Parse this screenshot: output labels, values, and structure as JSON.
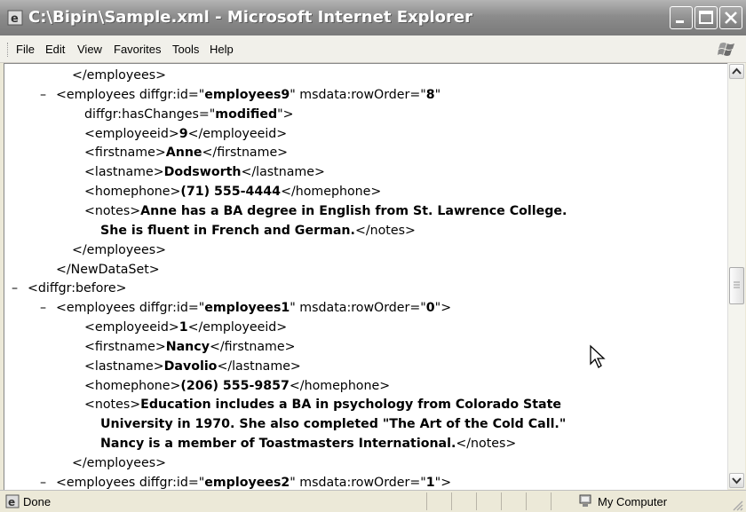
{
  "window": {
    "title": "C:\\Bipin\\Sample.xml - Microsoft Internet Explorer"
  },
  "menu": [
    "File",
    "Edit",
    "View",
    "Favorites",
    "Tools",
    "Help"
  ],
  "xml_lines": [
    {
      "indent": 76,
      "parts": [
        [
          "t",
          "</employees>"
        ]
      ]
    },
    {
      "indent": 58,
      "dash": true,
      "parts": [
        [
          "t",
          "<employees diffgr:id=\""
        ],
        [
          "v",
          "employees9"
        ],
        [
          "t",
          "\" msdata:rowOrder=\""
        ],
        [
          "v",
          "8"
        ],
        [
          "t",
          "\""
        ]
      ]
    },
    {
      "indent": 90,
      "parts": [
        [
          "t",
          "diffgr:hasChanges=\""
        ],
        [
          "v",
          "modified"
        ],
        [
          "t",
          "\">"
        ]
      ]
    },
    {
      "indent": 90,
      "parts": [
        [
          "t",
          "<employeeid>"
        ],
        [
          "v",
          "9"
        ],
        [
          "t",
          "</employeeid>"
        ]
      ]
    },
    {
      "indent": 90,
      "parts": [
        [
          "t",
          "<firstname>"
        ],
        [
          "v",
          "Anne"
        ],
        [
          "t",
          "</firstname>"
        ]
      ]
    },
    {
      "indent": 90,
      "parts": [
        [
          "t",
          "<lastname>"
        ],
        [
          "v",
          "Dodsworth"
        ],
        [
          "t",
          "</lastname>"
        ]
      ]
    },
    {
      "indent": 90,
      "parts": [
        [
          "t",
          "<homephone>"
        ],
        [
          "v",
          "(71) 555-4444"
        ],
        [
          "t",
          "</homephone>"
        ]
      ]
    },
    {
      "indent": 90,
      "parts": [
        [
          "t",
          "<notes>"
        ],
        [
          "v",
          "Anne has a BA degree in English from St. Lawrence College."
        ]
      ]
    },
    {
      "indent": 108,
      "parts": [
        [
          "v",
          "She is fluent in French and German."
        ],
        [
          "t",
          "</notes>"
        ]
      ]
    },
    {
      "indent": 76,
      "parts": [
        [
          "t",
          "</employees>"
        ]
      ]
    },
    {
      "indent": 58,
      "parts": [
        [
          "t",
          "</NewDataSet>"
        ]
      ]
    },
    {
      "indent": 26,
      "dash": true,
      "parts": [
        [
          "t",
          "<diffgr:before>"
        ]
      ]
    },
    {
      "indent": 58,
      "dash": true,
      "parts": [
        [
          "t",
          "<employees diffgr:id=\""
        ],
        [
          "v",
          "employees1"
        ],
        [
          "t",
          "\" msdata:rowOrder=\""
        ],
        [
          "v",
          "0"
        ],
        [
          "t",
          "\">"
        ]
      ]
    },
    {
      "indent": 90,
      "parts": [
        [
          "t",
          "<employeeid>"
        ],
        [
          "v",
          "1"
        ],
        [
          "t",
          "</employeeid>"
        ]
      ]
    },
    {
      "indent": 90,
      "parts": [
        [
          "t",
          "<firstname>"
        ],
        [
          "v",
          "Nancy"
        ],
        [
          "t",
          "</firstname>"
        ]
      ]
    },
    {
      "indent": 90,
      "parts": [
        [
          "t",
          "<lastname>"
        ],
        [
          "v",
          "Davolio"
        ],
        [
          "t",
          "</lastname>"
        ]
      ]
    },
    {
      "indent": 90,
      "parts": [
        [
          "t",
          "<homephone>"
        ],
        [
          "v",
          "(206) 555-9857"
        ],
        [
          "t",
          "</homephone>"
        ]
      ]
    },
    {
      "indent": 90,
      "parts": [
        [
          "t",
          "<notes>"
        ],
        [
          "v",
          "Education includes a BA in psychology from Colorado State"
        ]
      ]
    },
    {
      "indent": 108,
      "parts": [
        [
          "v",
          "University in 1970. She also completed \"The Art of the Cold Call.\""
        ]
      ]
    },
    {
      "indent": 108,
      "parts": [
        [
          "v",
          "Nancy is a member of Toastmasters International."
        ],
        [
          "t",
          "</notes>"
        ]
      ]
    },
    {
      "indent": 76,
      "parts": [
        [
          "t",
          "</employees>"
        ]
      ]
    },
    {
      "indent": 58,
      "dash": true,
      "parts": [
        [
          "t",
          "<employees diffgr:id=\""
        ],
        [
          "v",
          "employees2"
        ],
        [
          "t",
          "\" msdata:rowOrder=\""
        ],
        [
          "v",
          "1"
        ],
        [
          "t",
          "\">"
        ]
      ]
    }
  ],
  "status": {
    "left_text": "Done",
    "zone_text": "My Computer"
  }
}
